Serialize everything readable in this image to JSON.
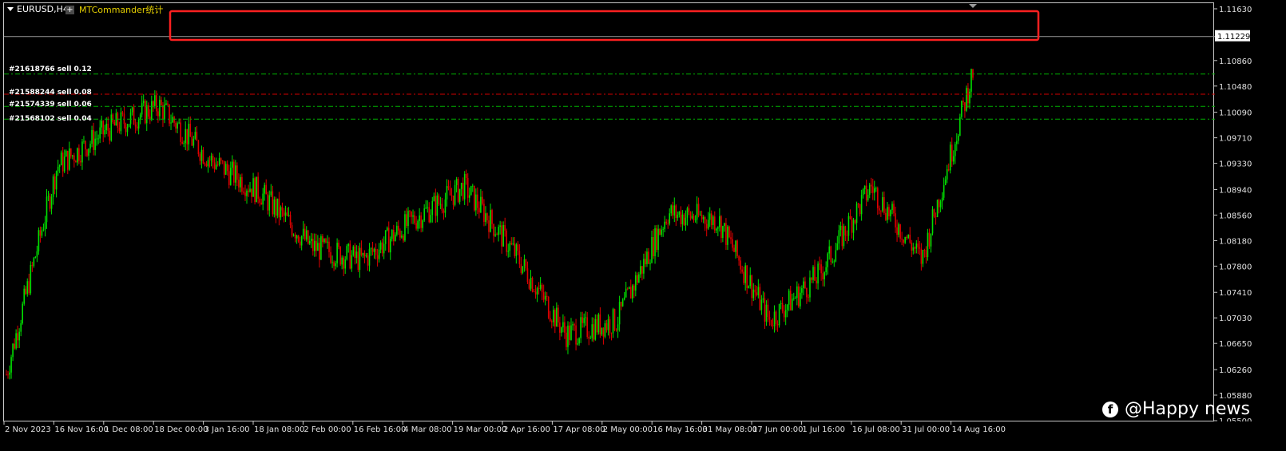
{
  "chart": {
    "symbol": "EURUSD,H4",
    "expert_name": "MTCommander统计",
    "expert_button": "+",
    "current_price": "1.11229",
    "colors": {
      "background": "#000000",
      "bull": "#00e000",
      "bear": "#e00000",
      "order_green": "#00b000",
      "order_red": "#d00000",
      "highlight_box": "#ff2020"
    }
  },
  "orders": [
    {
      "label": "#21618766 sell 0.12",
      "price": 1.1067,
      "color": "green"
    },
    {
      "label": "#21588244 sell 0.08",
      "price": 1.1037,
      "color": "red"
    },
    {
      "label": "#21574339 sell 0.06",
      "price": 1.1019,
      "color": "green"
    },
    {
      "label": "#21568102 sell 0.04",
      "price": 1.1,
      "color": "green"
    }
  ],
  "price_axis": {
    "ticks": [
      "1.11630",
      "1.10860",
      "1.10480",
      "1.10090",
      "1.09710",
      "1.09330",
      "1.08940",
      "1.08560",
      "1.08180",
      "1.07800",
      "1.07410",
      "1.07030",
      "1.06650",
      "1.06260",
      "1.05880",
      "1.05500"
    ],
    "min": 1.055,
    "max": 1.1163
  },
  "time_axis": {
    "labels": [
      "2 Nov 2023",
      "16 Nov 16:00",
      "1 Dec 08:00",
      "18 Dec 00:00",
      "3 Jan 16:00",
      "18 Jan 08:00",
      "2 Feb 00:00",
      "16 Feb 16:00",
      "4 Mar 08:00",
      "19 Mar 00:00",
      "2 Apr 16:00",
      "17 Apr 08:00",
      "2 May 00:00",
      "16 May 16:00",
      "31 May 08:00",
      "17 Jun 00:00",
      "1 Jul 16:00",
      "16 Jul 08:00",
      "31 Jul 00:00",
      "14 Aug 16:00"
    ]
  },
  "chart_data": {
    "type": "line",
    "x": [
      "2 Nov 2023",
      "16 Nov 16:00",
      "1 Dec 08:00",
      "18 Dec 00:00",
      "3 Jan 16:00",
      "18 Jan 08:00",
      "2 Feb 00:00",
      "16 Feb 16:00",
      "4 Mar 08:00",
      "19 Mar 00:00",
      "2 Apr 16:00",
      "17 Apr 08:00",
      "2 May 00:00",
      "16 May 16:00",
      "31 May 08:00",
      "17 Jun 00:00",
      "1 Jul 16:00",
      "16 Jul 08:00",
      "31 Jul 00:00",
      "14 Aug 16:00"
    ],
    "series": [
      {
        "values": [
          1.062,
          1.093,
          1.0985,
          1.102,
          1.094,
          1.089,
          1.081,
          1.079,
          1.085,
          1.09,
          1.08,
          1.068,
          1.07,
          1.086,
          1.085,
          1.07,
          1.077,
          1.09,
          1.079,
          1.107
        ]
      }
    ],
    "ylim": [
      1.055,
      1.1163
    ],
    "grid": false,
    "current_value": 1.11229
  },
  "watermark": {
    "icon": "facebook-icon",
    "glyph": "f",
    "text": "@Happy  news"
  }
}
